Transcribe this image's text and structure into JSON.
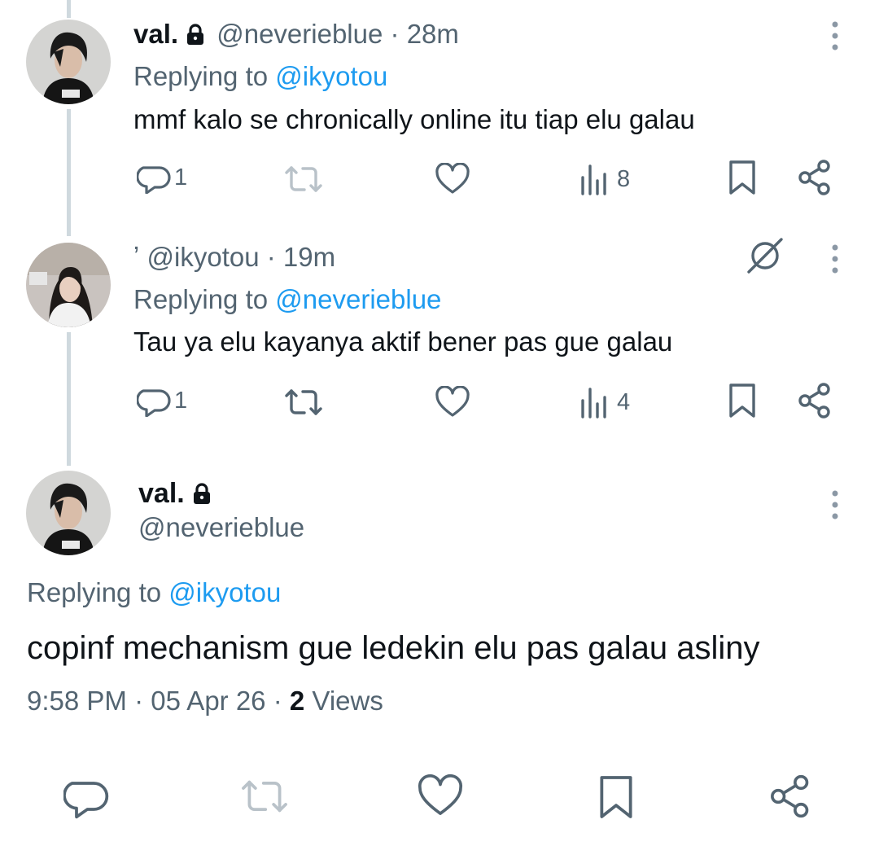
{
  "tweets": [
    {
      "name": "val.",
      "handle": "@neverieblue",
      "time": "28m",
      "replying_prefix": "Replying to",
      "replying_to": "@ikyotou",
      "text": "mmf kalo se chronically online itu tiap elu galau",
      "replies": "1",
      "views": "8"
    },
    {
      "name_fragment": "ʼ",
      "handle": "@ikyotou",
      "time": "19m",
      "replying_prefix": "Replying to",
      "replying_to": "@neverieblue",
      "text": "Tau ya elu kayanya aktif bener pas gue galau",
      "replies": "1",
      "views": "4"
    }
  ],
  "detail": {
    "name": "val.",
    "handle": "@neverieblue",
    "replying_prefix": "Replying to",
    "replying_to": "@ikyotou",
    "text": "copinf mechanism gue ledekin elu pas galau asliny",
    "time": "9:58 PM",
    "date": "05 Apr 26",
    "views_count": "2",
    "views_label": "Views"
  },
  "separator": "·",
  "colors": {
    "text": "#0f1419",
    "secondary": "#536471",
    "link": "#1d9bf0",
    "thread_line": "#cfd9de",
    "muted_icon": "#b9c2c9"
  },
  "icons": {
    "reply": "speech-bubble-icon",
    "retweet": "retweet-arrows-icon",
    "like": "heart-icon",
    "views": "bar-chart-icon",
    "bookmark": "bookmark-icon",
    "share": "share-nodes-icon",
    "grok": "grok-slash-icon",
    "more": "vertical-dots-icon",
    "lock": "padlock-icon"
  }
}
